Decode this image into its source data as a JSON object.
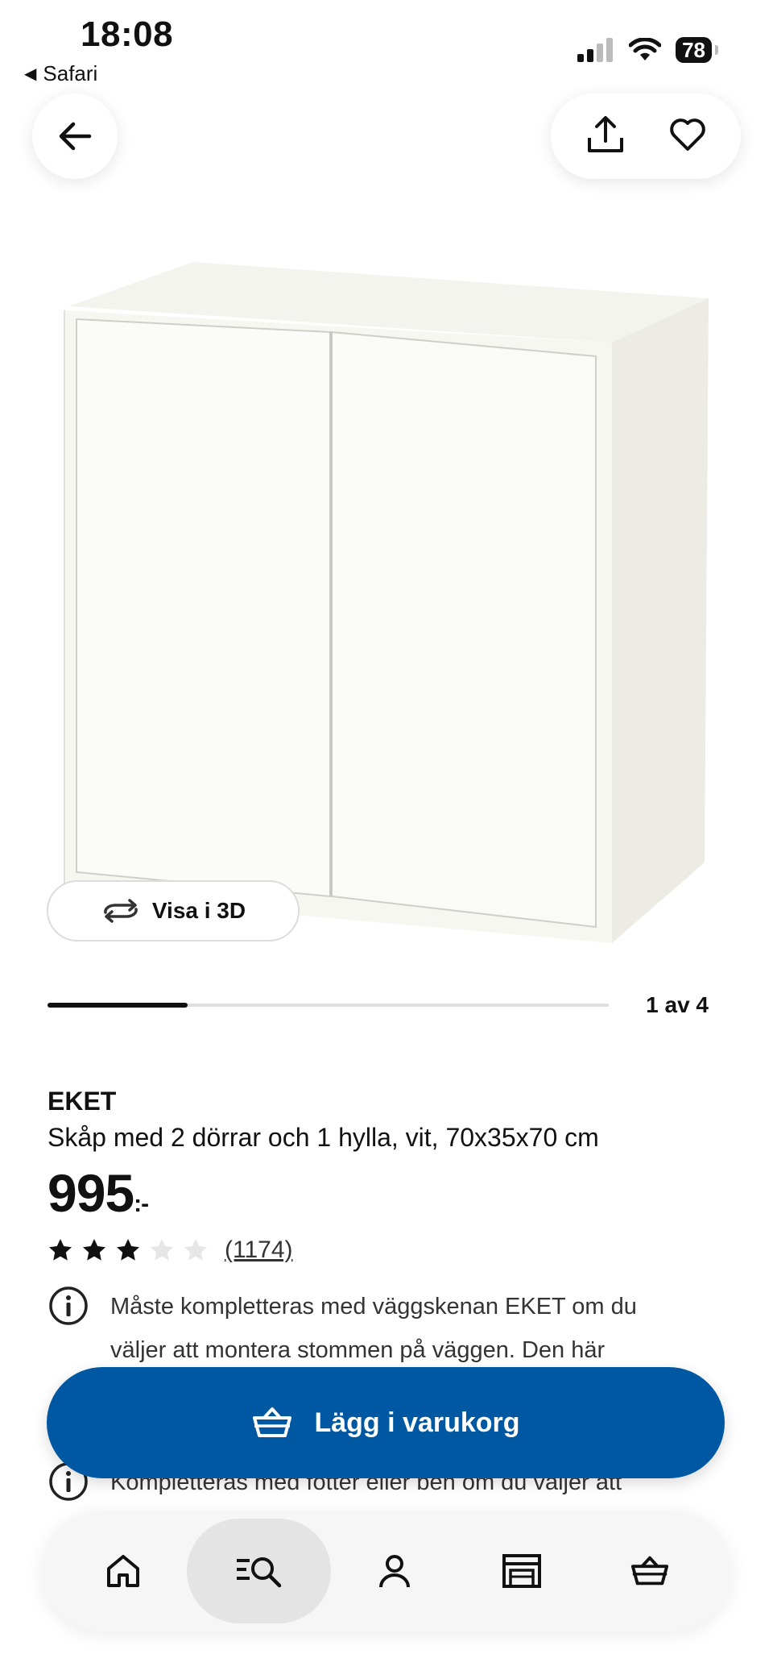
{
  "status_bar": {
    "time": "18:08",
    "back_app": "Safari",
    "battery": "78"
  },
  "top_bar": {
    "back_icon": "arrow-left-icon",
    "share_icon": "share-icon",
    "favorite_icon": "heart-icon"
  },
  "gallery": {
    "view_3d_label": "Visa i 3D",
    "counter": "1 av 4",
    "progress": 0.25
  },
  "product": {
    "brand": "EKET",
    "description": "Skåp med 2 dörrar och 1 hylla, vit, 70x35x70 cm",
    "price": "995",
    "price_suffix": ":-",
    "rating": 3,
    "rating_max": 5,
    "review_count": "(1174)",
    "info_1": "Måste kompletteras med väggskenan EKET om du väljer att montera stommen på väggen. Den här",
    "info_2": "Kompletteras med fötter eller ben om du väljer att"
  },
  "cta": {
    "label": "Lägg i varukorg",
    "color": "#0058a3"
  },
  "tabbar": {
    "items": [
      {
        "icon": "home-icon"
      },
      {
        "icon": "search-list-icon",
        "active": true
      },
      {
        "icon": "profile-icon"
      },
      {
        "icon": "store-icon"
      },
      {
        "icon": "basket-icon"
      }
    ]
  }
}
